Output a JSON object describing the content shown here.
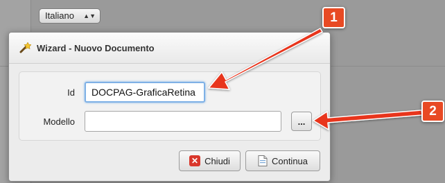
{
  "background": {
    "language_select": {
      "value": "Italiano"
    }
  },
  "dialog": {
    "title": "Wizard - Nuovo Documento",
    "form": {
      "id_label": "Id",
      "id_value": "DOCPAG-GraficaRetina",
      "modello_label": "Modello",
      "modello_value": "",
      "browse_label": "..."
    },
    "buttons": {
      "close_label": "Chiudi",
      "continue_label": "Continua"
    }
  },
  "annotations": {
    "badge_1": "1",
    "badge_2": "2",
    "arrow_color": "#e8341f"
  }
}
